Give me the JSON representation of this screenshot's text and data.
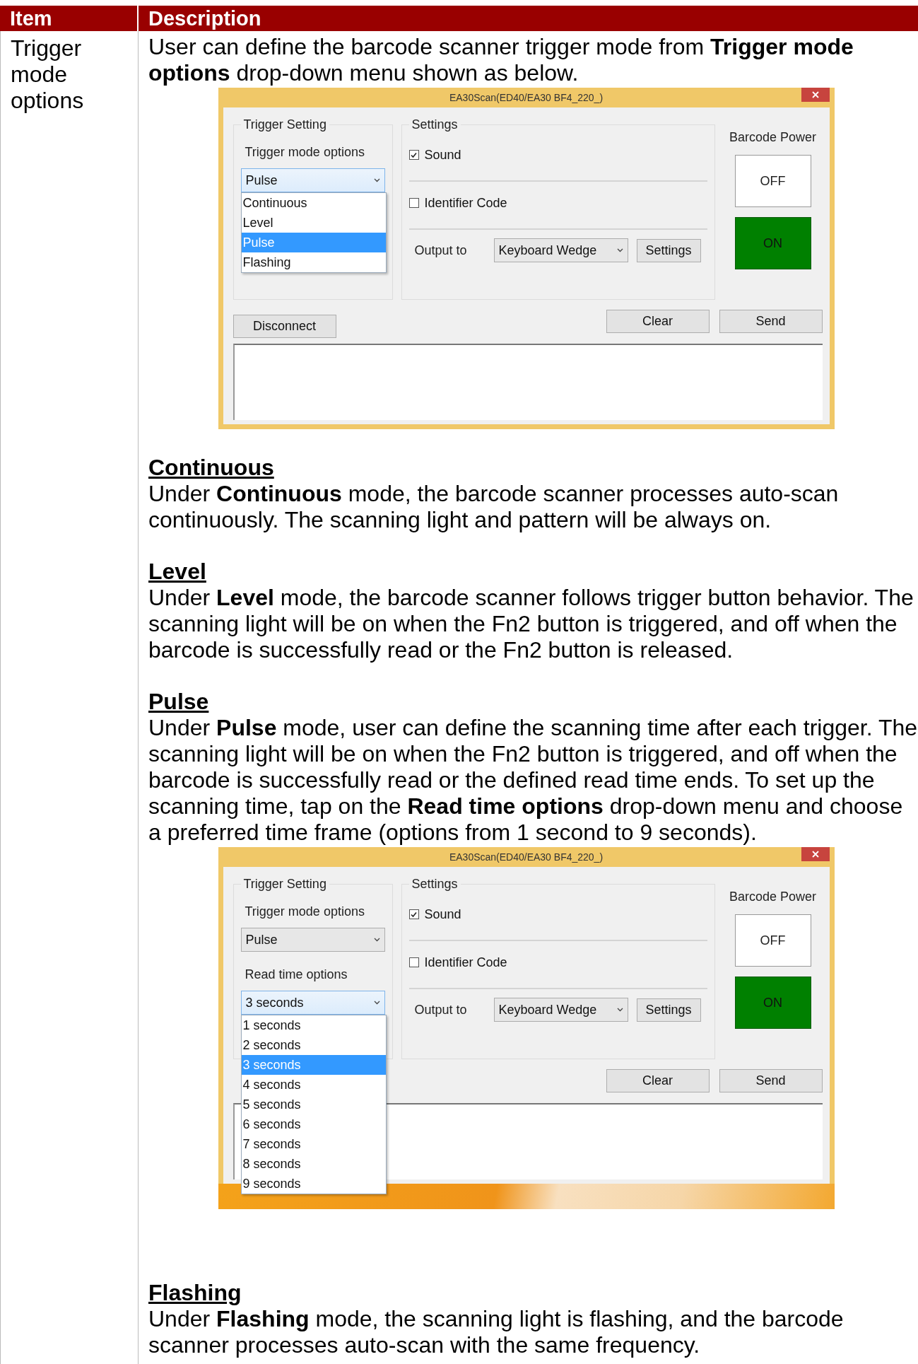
{
  "table": {
    "columns": [
      "Item",
      "Description"
    ],
    "rows": [
      {
        "item": "Trigger mode options",
        "blocks": [
          {
            "kind": "paragraph",
            "text": "User can define the barcode scanner trigger mode from **Trigger mode options** drop-down menu shown as below."
          },
          {
            "kind": "dialog",
            "title": "EA30Scan(ED40/EA30 BF4_220_)",
            "desktop_strip": false,
            "trigger_setting": {
              "title": "Trigger Setting",
              "fields": [
                {
                  "label": "Trigger mode options",
                  "value": "Pulse",
                  "expanded": true,
                  "options": [
                    {
                      "label": "Continuous",
                      "selected": false
                    },
                    {
                      "label": "Level",
                      "selected": false
                    },
                    {
                      "label": "Pulse",
                      "selected": true
                    },
                    {
                      "label": "Flashing",
                      "selected": false
                    }
                  ]
                }
              ]
            },
            "settings": {
              "title": "Settings",
              "checkboxes": [
                {
                  "label": "Sound",
                  "checked": true
                },
                {
                  "label": "Identifier Code",
                  "checked": false
                }
              ],
              "output_label": "Output to",
              "output_value": "Keyboard Wedge",
              "button": "Settings"
            },
            "barcode_power": {
              "title": "Barcode Power",
              "buttons": [
                {
                  "label": "OFF",
                  "selected": false
                },
                {
                  "label": "ON",
                  "selected": true
                }
              ]
            },
            "left_buttons": [
              "Disconnect"
            ],
            "right_buttons": [
              "Clear",
              "Send"
            ]
          },
          {
            "kind": "heading",
            "text": "Continuous"
          },
          {
            "kind": "paragraph",
            "text": "Under **Continuous** mode, the barcode scanner processes auto-scan continuously. The scanning light and pattern will be always on."
          },
          {
            "kind": "heading",
            "text": "Level"
          },
          {
            "kind": "paragraph",
            "text": "Under **Level** mode, the barcode scanner follows trigger button behavior. The scanning light will be on when the Fn2 button is triggered, and off when the barcode is successfully read or the Fn2 button is released."
          },
          {
            "kind": "heading",
            "text": "Pulse"
          },
          {
            "kind": "paragraph",
            "text": "Under **Pulse** mode, user can define the scanning time after each trigger. The scanning light will be on when the Fn2 button is triggered, and off when the barcode is successfully read or the defined read time ends. To set up the scanning time, tap on the **Read time options** drop-down menu and choose a preferred time frame (options from 1 second to 9 seconds)."
          },
          {
            "kind": "dialog",
            "title": "EA30Scan(ED40/EA30 BF4_220_)",
            "desktop_strip": true,
            "trigger_setting": {
              "title": "Trigger Setting",
              "fields": [
                {
                  "label": "Trigger mode options",
                  "value": "Pulse",
                  "expanded": false
                },
                {
                  "label": "Read time options",
                  "value": "3 seconds",
                  "expanded": true,
                  "options": [
                    {
                      "label": "1 seconds",
                      "selected": false
                    },
                    {
                      "label": "2 seconds",
                      "selected": false
                    },
                    {
                      "label": "3 seconds",
                      "selected": true
                    },
                    {
                      "label": "4 seconds",
                      "selected": false
                    },
                    {
                      "label": "5 seconds",
                      "selected": false
                    },
                    {
                      "label": "6 seconds",
                      "selected": false
                    },
                    {
                      "label": "7 seconds",
                      "selected": false
                    },
                    {
                      "label": "8 seconds",
                      "selected": false
                    },
                    {
                      "label": "9 seconds",
                      "selected": false
                    }
                  ]
                }
              ]
            },
            "settings": {
              "title": "Settings",
              "checkboxes": [
                {
                  "label": "Sound",
                  "checked": true
                },
                {
                  "label": "Identifier Code",
                  "checked": false
                }
              ],
              "output_label": "Output to",
              "output_value": "Keyboard Wedge",
              "button": "Settings"
            },
            "barcode_power": {
              "title": "Barcode Power",
              "buttons": [
                {
                  "label": "OFF",
                  "selected": false
                },
                {
                  "label": "ON",
                  "selected": true
                }
              ]
            },
            "right_buttons": [
              "Clear",
              "Send"
            ]
          },
          {
            "kind": "spacer_heading",
            "text": "Flashing"
          },
          {
            "kind": "paragraph",
            "text": "Under **Flashing** mode, the scanning light is flashing, and the barcode scanner processes auto-scan with the same frequency."
          }
        ]
      }
    ]
  }
}
